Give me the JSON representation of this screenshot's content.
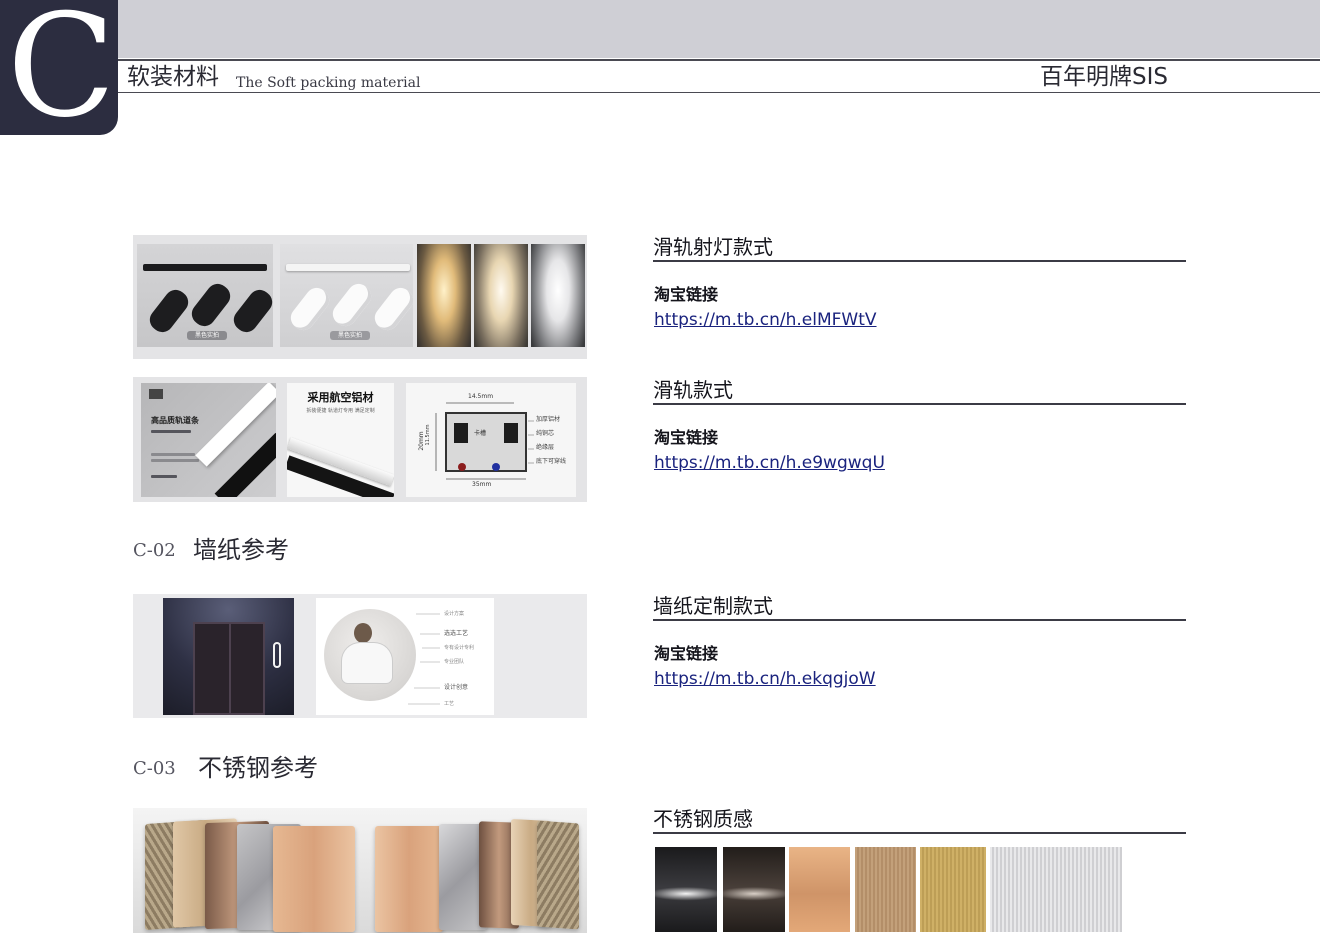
{
  "header": {
    "logo_letter": "C",
    "section_cn": "软装材料",
    "section_en": "The Soft packing material",
    "brand": "百年明牌SIS"
  },
  "images": {
    "spotlight_tags": [
      "黑色实拍",
      "黑色实拍"
    ],
    "track_panel": {
      "left_title": "高品质轨道条",
      "right_title": "采用航空铝材",
      "right_subtitle": "拆装便捷 轨道灯专用 满足定制",
      "dim_width_top": "14.5mm",
      "dim_width_bottom": "35mm",
      "dim_height": "20mm",
      "dim_inner_height": "11.5mm",
      "slot_label": "卡槽",
      "legend": [
        "加厚铝材",
        "纯铜芯",
        "绝缘层",
        "底下可穿线"
      ]
    },
    "wallpaper_callouts": [
      "设计方案",
      "选选工艺",
      "专有设计专利",
      "专业团队",
      "设计创意",
      "工艺"
    ]
  },
  "items": [
    {
      "title": "滑轨射灯款式",
      "label": "淘宝链接",
      "link": "https://m.tb.cn/h.elMFWtV"
    },
    {
      "title": "滑轨款式",
      "label": "淘宝链接",
      "link": "https://m.tb.cn/h.e9wgwqU"
    },
    {
      "title": "墙纸定制款式",
      "label": "淘宝链接",
      "link": "https://m.tb.cn/h.ekqgjoW"
    },
    {
      "title": "不锈钢质感"
    }
  ],
  "sections": [
    {
      "code": "C-02",
      "title": "墙纸参考"
    },
    {
      "code": "C-03",
      "title": "不锈钢参考"
    }
  ],
  "colors": {
    "header_band": "#cfcfd5",
    "logo_block": "#2c2d40",
    "link": "#1a237e",
    "rule": "#3b3b45"
  }
}
